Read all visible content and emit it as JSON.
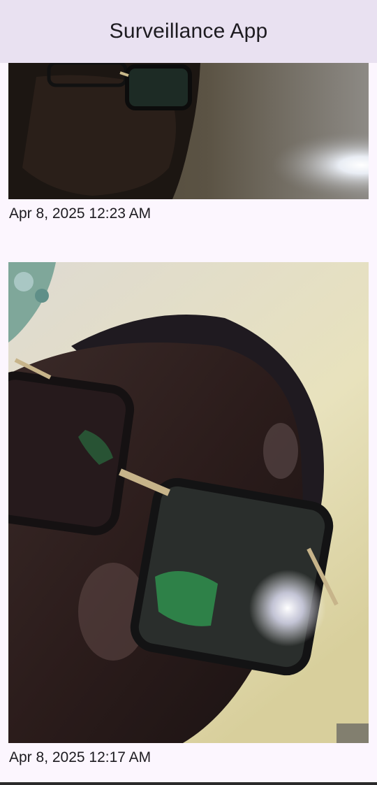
{
  "app_bar": {
    "title": "Surveillance App"
  },
  "captures": [
    {
      "image": "captured-photo-person-glasses",
      "timestamp": "Apr 8, 2025  12:23 AM"
    },
    {
      "image": "captured-photo-person-glasses-closeup",
      "timestamp": "Apr 8, 2025  12:17 AM"
    }
  ]
}
